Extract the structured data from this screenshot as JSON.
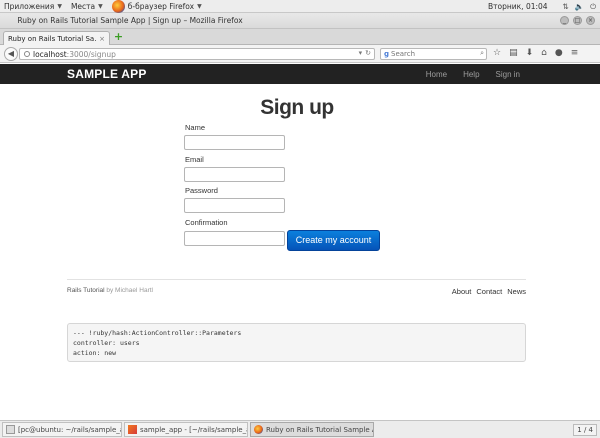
{
  "topbar": {
    "apps_label": "Приложения",
    "places_label": "Места",
    "browser_label": "б-браузер Firefox",
    "clock": "Вторник, 01:04"
  },
  "window": {
    "title": "Ruby on Rails Tutorial Sample App | Sign up – Mozilla Firefox"
  },
  "tab": {
    "label": "Ruby on Rails Tutorial Sa..."
  },
  "nav": {
    "url_host": "localhost",
    "url_path": ":3000/signup",
    "search_placeholder": "Search"
  },
  "site": {
    "logo": "SAMPLE APP",
    "nav": [
      "Home",
      "Help",
      "Sign in"
    ]
  },
  "form": {
    "title": "Sign up",
    "name_label": "Name",
    "name_value": "",
    "email_label": "Email",
    "email_value": "",
    "password_label": "Password",
    "password_value": "",
    "confirmation_label": "Confirmation",
    "confirmation_value": "",
    "submit_label": "Create my account",
    "accent_color": "#0a69cf"
  },
  "footer": {
    "left_text": "Rails Tutorial",
    "left_by": "by Michael Hartl",
    "links": [
      "About",
      "Contact",
      "News"
    ]
  },
  "debug": {
    "lines": [
      "--- !ruby/hash:ActionController::Parameters",
      "controller: users",
      "action: new"
    ]
  },
  "taskbar": {
    "tasks": [
      {
        "label": "[pc@ubuntu: ~/rails/sample_app]",
        "icon": "terminal-icon"
      },
      {
        "label": "sample_app - [~/rails/sample_app...",
        "icon": "rubymine-icon"
      },
      {
        "label": "Ruby on Rails Tutorial Sample Ap...",
        "icon": "firefox-icon"
      }
    ],
    "workspace": "1 / 4"
  }
}
